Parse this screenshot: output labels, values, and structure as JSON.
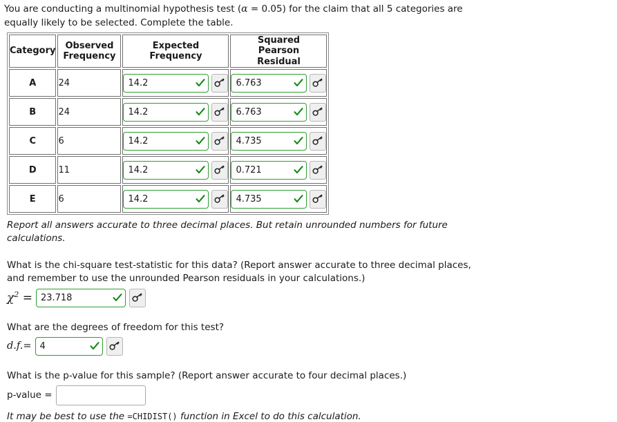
{
  "prompt": {
    "before_alpha": "You are conducting a multinomial hypothesis test (",
    "alpha_symbol": "α",
    "after_alpha": " = 0.05) for the claim that all 5 categories are equally likely to be selected. Complete the table."
  },
  "table": {
    "headers": {
      "category": "Category",
      "observed": "Observed Frequency",
      "observed_line1": "Observed",
      "observed_line2": "Frequency",
      "expected_line1": "Expected",
      "expected_line2": "Frequency",
      "squared_line1": "Squared",
      "squared_line2": "Pearson",
      "squared_line3": "Residual"
    },
    "rows": [
      {
        "category": "A",
        "observed": "24",
        "expected": "14.2",
        "squared_residual": "6.763",
        "expected_valid": true,
        "squared_valid": true
      },
      {
        "category": "B",
        "observed": "24",
        "expected": "14.2",
        "squared_residual": "6.763",
        "expected_valid": true,
        "squared_valid": true
      },
      {
        "category": "C",
        "observed": "6",
        "expected": "14.2",
        "squared_residual": "4.735",
        "expected_valid": true,
        "squared_valid": true
      },
      {
        "category": "D",
        "observed": "11",
        "expected": "14.2",
        "squared_residual": "0.721",
        "expected_valid": true,
        "squared_valid": true
      },
      {
        "category": "E",
        "observed": "6",
        "expected": "14.2",
        "squared_residual": "4.735",
        "expected_valid": true,
        "squared_valid": true
      }
    ]
  },
  "notes": {
    "rounding": "Report all answers accurate to three decimal places. But retain unrounded numbers for future calculations.",
    "excel_before": "It may be best to use the ",
    "excel_code": "=CHIDIST()",
    "excel_after": " function in Excel to do this calculation."
  },
  "chi_square": {
    "question": "What is the chi-square test-statistic for this data? (Report answer accurate to three decimal places, and remember to use the unrounded Pearson residuals in your calculations.)",
    "label_symbol": "χ",
    "label_sup": "2",
    "label_equals": "=",
    "value": "23.718",
    "placeholder": ""
  },
  "degrees_of_freedom": {
    "question": "What are the degrees of freedom for this test?",
    "label": "d.f.=",
    "value": "4",
    "placeholder": ""
  },
  "p_value": {
    "question": "What is the p-value for this sample? (Report answer accurate to four decimal places.)",
    "label": "p-value =",
    "value": "",
    "placeholder": ""
  },
  "icons": {
    "key": "key-icon",
    "check": "check-icon"
  },
  "colors": {
    "valid_border": "#2e9e2e",
    "check_green": "#118811",
    "plain_border": "#a8a8a8",
    "table_border": "#6f6f6f",
    "button_face": "#efefef",
    "text": "#1a1a1a"
  }
}
